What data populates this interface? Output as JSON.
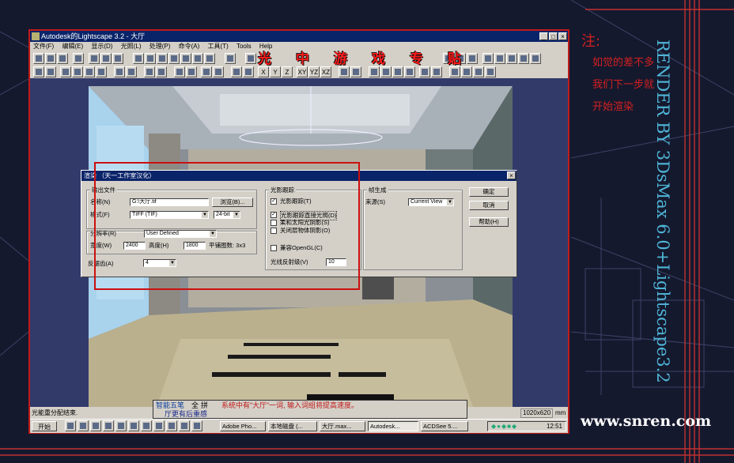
{
  "app": {
    "title": "Autodesk的Lightscape 3.2 - 大厅",
    "min_glyph": "_",
    "max_glyph": "□",
    "close_glyph": "×"
  },
  "menu": [
    "文件(F)",
    "编辑(E)",
    "显示(D)",
    "光照(L)",
    "处理(P)",
    "命令(A)",
    "工具(T)",
    "Tools",
    "Help"
  ],
  "toolbar2_labels": [
    "X",
    "Y",
    "Z",
    "XY",
    "YZ",
    "XZ"
  ],
  "overlay_title_chars": [
    "光",
    "中",
    "游",
    "戏",
    "专",
    "贴"
  ],
  "dialog": {
    "title": "渲染  （天一工作室汉化）",
    "close_glyph": "×",
    "output_group": "输出文件",
    "name_label": "名称(N)",
    "name_value": "G:\\大厅.tif",
    "browse_button": "浏览(B)...",
    "format_label": "格式(F)",
    "format_value": "TIFF (TIF)",
    "bits_value": "24-bit",
    "resolution_label": "分辨率(R)",
    "resolution_value": "User Defined",
    "width_label": "宽度(W)",
    "width_value": "2400",
    "height_label": "高度(H)",
    "height_value": "1800",
    "smooth_label": "平铺图数: 3x3",
    "antialias_label": "反锯齿(A)",
    "antialias_value": "4",
    "raytrace_group": "光影跟踪",
    "raytrace_options": [
      {
        "label": "光影跟踪(T)",
        "checked": true
      },
      {
        "label": "光影跟踪直接光照(D)",
        "checked": true
      },
      {
        "label": "柔和太阳光阴影(S)",
        "checked": false
      },
      {
        "label": "关闭层物体阴影(O)",
        "checked": false
      }
    ],
    "opengl_label": "兼容OpenGL(C)",
    "opengl_checked": false,
    "reflect_label": "光线反射级(V)",
    "reflect_value": "10",
    "frame_group": "帧生成",
    "source_label": "来源(S)",
    "source_value": "Current View",
    "ok_button": "确定",
    "cancel_button": "取消",
    "help_button": "帮助(H)"
  },
  "status": {
    "left": "光能重分配结束.",
    "resolution": "1020x620",
    "unit": "mm"
  },
  "taskbar": {
    "start": "开始",
    "items": [
      {
        "label": "Adobe Pho...",
        "active": false
      },
      {
        "label": "本地磁盘 (...",
        "active": false
      },
      {
        "label": "大厅.max...",
        "active": false
      },
      {
        "label": "Autodesk...",
        "active": true
      },
      {
        "label": "ACDSee 5....",
        "active": false
      }
    ],
    "clock": "12:51"
  },
  "ime": {
    "name": "智能五笔",
    "mode_left": "全",
    "mode_right": "拼",
    "message": "系统中有“大厅”一词, 输入词组将提高速度。",
    "candidates": "厅更有后重感"
  },
  "notes": {
    "heading": "注:",
    "lines": [
      "如觉的差不多",
      "我们下一步就",
      "开始渲染"
    ]
  },
  "side_text": "RENDER BY 3DsMax 6.0+Lightscape3.2",
  "watermark": "www.snren.com",
  "colors": {
    "accent_red": "#d42020",
    "title_blue": "#0a246a",
    "side_text": "#4fb6d8"
  }
}
